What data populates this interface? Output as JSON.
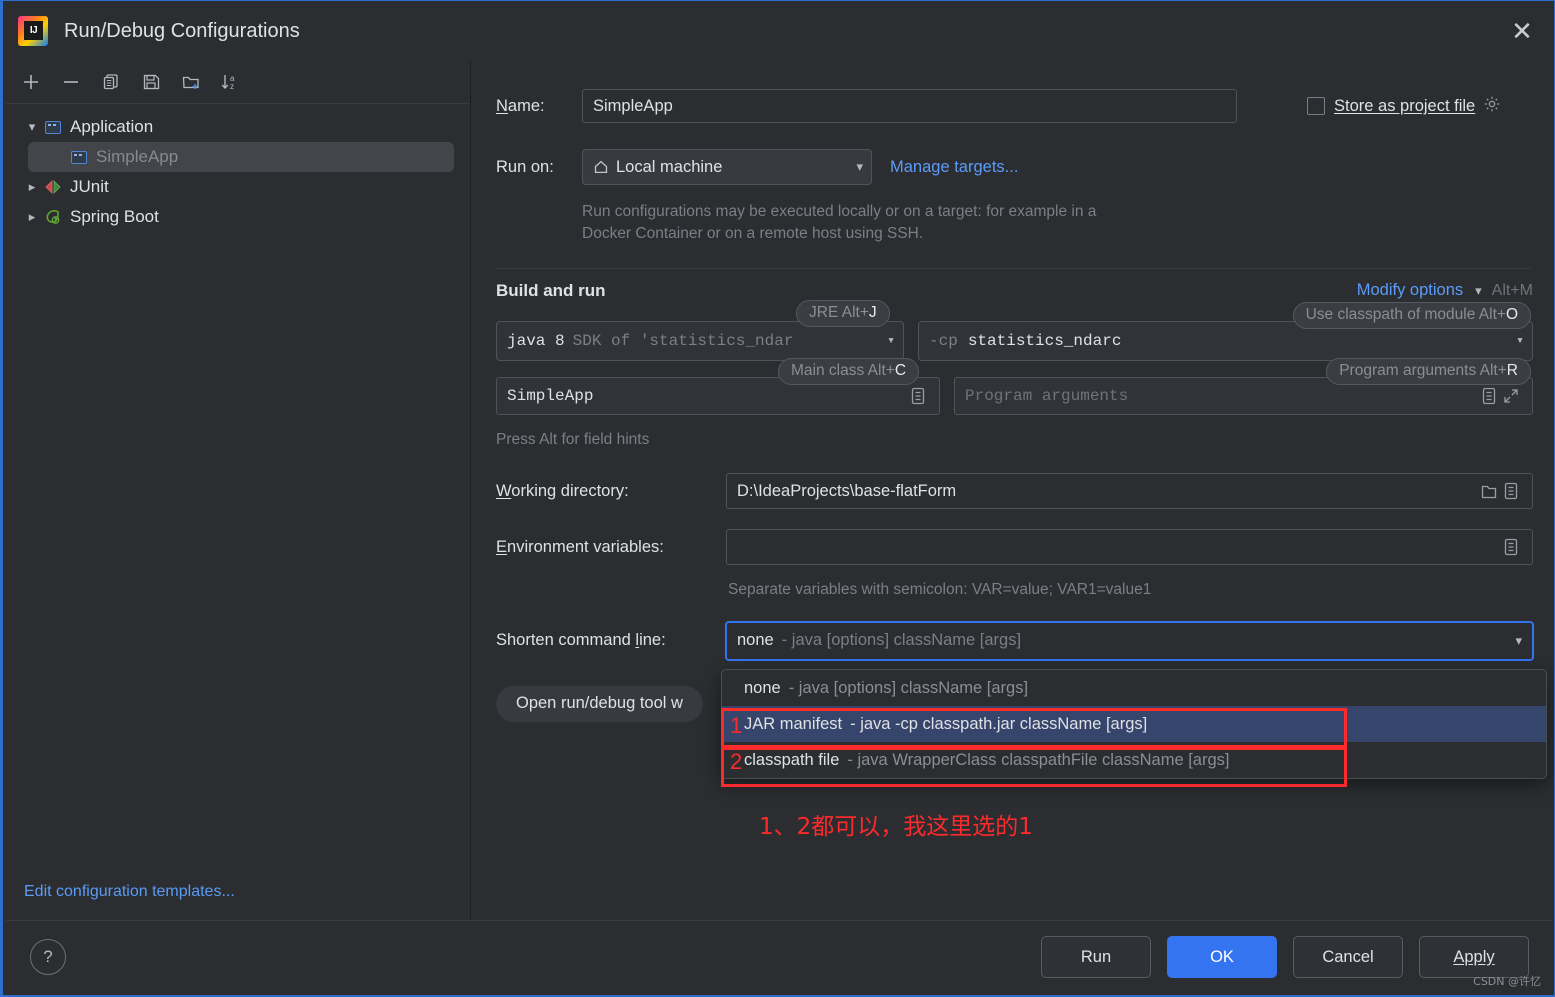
{
  "window": {
    "title": "Run/Debug Configurations",
    "logo_icon": "intellij-idea-logo",
    "close_icon": "close-icon"
  },
  "sidebar": {
    "toolbar": [
      {
        "name": "add-configuration-button",
        "icon": "plus-icon",
        "glyph": "+"
      },
      {
        "name": "remove-configuration-button",
        "icon": "minus-icon",
        "glyph": "−"
      },
      {
        "name": "copy-configuration-button",
        "icon": "copy-icon",
        "glyph": "❐"
      },
      {
        "name": "save-configuration-button",
        "icon": "save-floppy-icon",
        "glyph": "Ὃe"
      },
      {
        "name": "new-folder-button",
        "icon": "new-folder-icon",
        "glyph": "὜1"
      },
      {
        "name": "sort-configurations-button",
        "icon": "sort-az-icon",
        "glyph": "↓"
      }
    ],
    "tree": [
      {
        "label": "Application",
        "icon": "application-icon",
        "expanded": true,
        "level": 0,
        "selected": false
      },
      {
        "label": "SimpleApp",
        "icon": "application-icon",
        "level": 1,
        "selected": true
      },
      {
        "label": "JUnit",
        "icon": "junit-icon",
        "expanded": false,
        "level": 0,
        "selected": false
      },
      {
        "label": "Spring Boot",
        "icon": "spring-boot-icon",
        "expanded": false,
        "level": 0,
        "selected": false
      }
    ],
    "edit_templates_link": "Edit configuration templates..."
  },
  "form": {
    "name_label": "Name:",
    "name_value": "SimpleApp",
    "store_as_project_file_label": "Store as project file",
    "store_as_project_file_checked": false,
    "store_gear_icon": "gear-icon",
    "run_on_label": "Run on:",
    "run_on_value": "Local machine",
    "run_on_icon": "home-icon",
    "manage_targets_link": "Manage targets...",
    "run_on_description": "Run configurations may be executed locally or on a target: for example in a Docker Container or on a remote host using SSH.",
    "build_and_run_title": "Build and run",
    "modify_options_link": "Modify options",
    "modify_options_shortcut": "Alt+M",
    "jre_hint": "JRE Alt+",
    "jre_hint_key": "J",
    "jre_value_bold": "java 8",
    "jre_value_dim": "SDK of 'statistics_ndar",
    "classpath_hint": "Use classpath of module Alt+",
    "classpath_hint_key": "O",
    "classpath_prefix": "-cp",
    "classpath_value": "statistics_ndarc",
    "main_class_hint": "Main class Alt+",
    "main_class_hint_key": "C",
    "main_class_value": "SimpleApp",
    "main_class_expand_icon": "expand-field-icon",
    "program_args_hint": "Program arguments Alt+",
    "program_args_hint_key": "R",
    "program_args_placeholder": "Program arguments",
    "program_args_expand_icon": "expand-field-icon",
    "program_args_fullscreen_icon": "expand-diagonal-icon",
    "press_alt_hint": "Press Alt for field hints",
    "working_directory_label": "Working directory:",
    "working_directory_value": "D:\\IdeaProjects\\base-flatForm",
    "working_directory_browse_icon": "folder-icon",
    "working_directory_expand_icon": "expand-field-icon",
    "environment_variables_label": "Environment variables:",
    "environment_variables_value": "",
    "environment_variables_expand_icon": "expand-field-icon",
    "environment_variables_hint": "Separate variables with semicolon: VAR=value; VAR1=value1",
    "shorten_command_line_label": "Shorten command line:",
    "shorten_command_line_value_bold": "none",
    "shorten_command_line_value_dim": "- java [options] className [args]",
    "open_tool_window_label": "Open run/debug tool w"
  },
  "dropdown": {
    "items": [
      {
        "bold": "none",
        "dim": "- java [options] className [args]",
        "highlighted": false
      },
      {
        "bold": "JAR manifest",
        "dim": "- java -cp classpath.jar className [args]",
        "highlighted": true
      },
      {
        "bold": "classpath file",
        "dim": "- java WrapperClass classpathFile className [args]",
        "highlighted": false
      }
    ]
  },
  "annotations": {
    "marker_1": "1",
    "marker_2": "2",
    "note": "1、2都可以，我这里选的1",
    "color": "#fc2b2b"
  },
  "footer": {
    "help_icon": "question-mark-icon",
    "buttons": [
      {
        "label": "Run",
        "primary": false,
        "name": "run-button"
      },
      {
        "label": "OK",
        "primary": true,
        "name": "ok-button"
      },
      {
        "label": "Cancel",
        "primary": false,
        "name": "cancel-button"
      },
      {
        "label": "Apply",
        "primary": false,
        "name": "apply-button"
      }
    ],
    "watermark": "CSDN @许忆"
  },
  "colors": {
    "accent": "#3574f0",
    "link": "#5a9cf8",
    "window_bg": "#2b2d30",
    "annotation_red": "#fc2b2b",
    "highlight_row": "#36456b"
  }
}
